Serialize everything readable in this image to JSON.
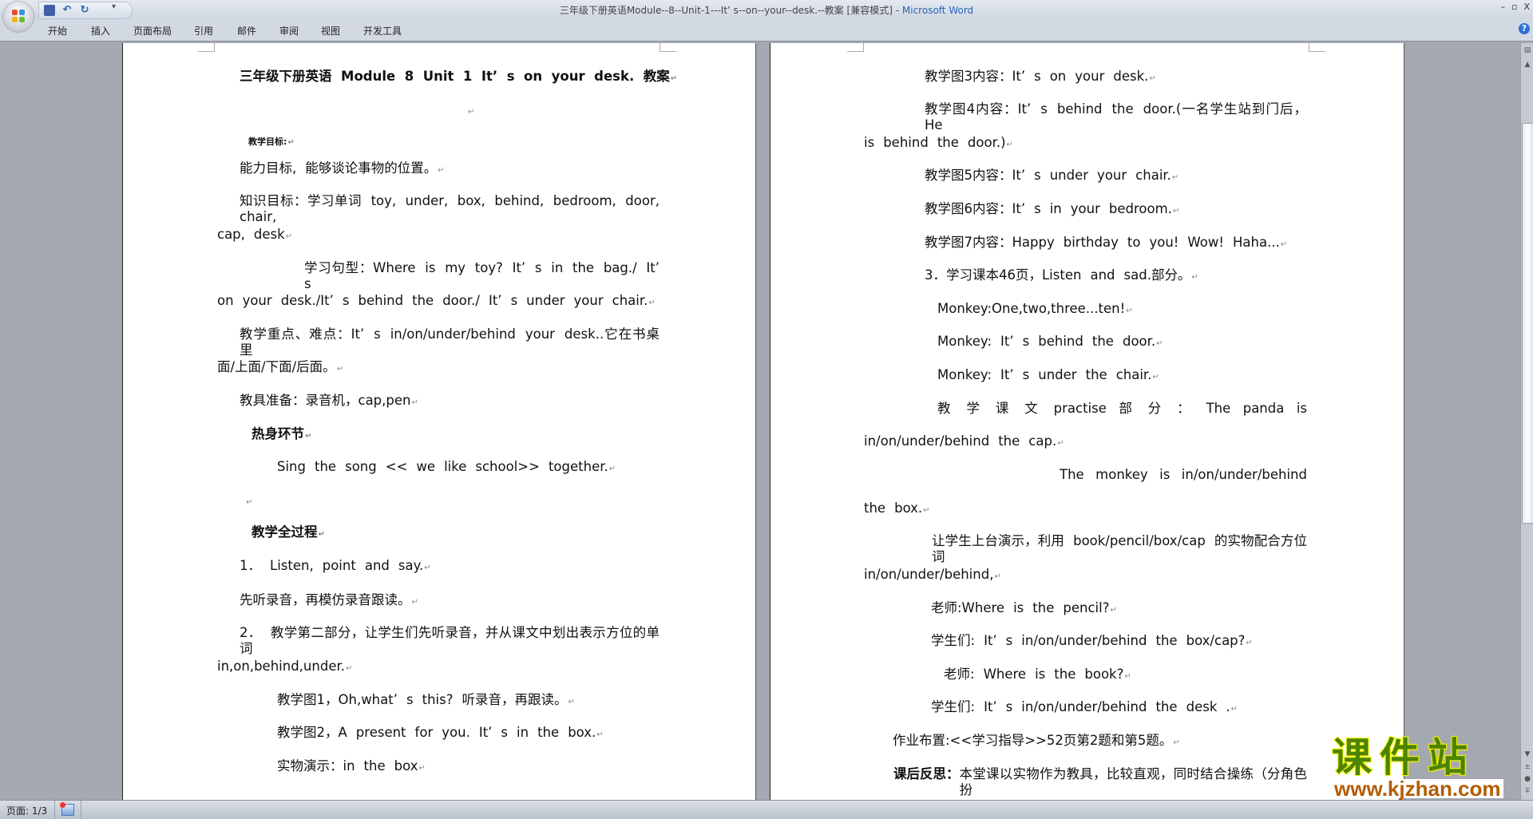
{
  "window": {
    "title": "三年级下册英语Module--8--Unit-1---It’ s--on--your--desk.--教案 [兼容模式]",
    "title_sep": " - ",
    "app_name": "Microsoft Word",
    "controls": [
      "–",
      "▫",
      "X"
    ]
  },
  "quick_access": {
    "icons": [
      "save-icon",
      "undo-icon",
      "redo-icon"
    ],
    "more": "▾"
  },
  "ribbon": {
    "tabs": [
      "开始",
      "插入",
      "页面布局",
      "引用",
      "邮件",
      "审阅",
      "视图",
      "开发工具"
    ],
    "help": "?"
  },
  "doc": {
    "left": [
      "三年级下册英语 Module  8  Unit 1   It’ s  on  your  desk.  教案",
      "",
      "教学目标:",
      "能力目标, 能够谈论事物的位置。",
      "知识目标：学习单词 toy,  under, box, behind, bedroom, door, chair,",
      "cap, desk",
      "学习句型：Where is  my  toy? It’ s  in  the  bag./ It’ s",
      "on  your desk./It’ s  behind  the  door./ It’ s  under  your chair.",
      "教学重点、难点：It’ s  in/on/under/behind  your  desk..它在书桌里",
      "面/上面/下面/后面。",
      "教具准备：录音机，cap,pen",
      "热身环节",
      "Sing  the  song  << we  like  school>>  together.",
      "",
      "教学全过程",
      "1． Listen, point  and  say.",
      "先听录音，再模仿录音跟读。",
      "2． 教学第二部分，让学生们先听录音，并从课文中划出表示方位的单词",
      "in,on,behind,under.",
      "教学图1，Oh,what’ s  this? 听录音，再跟读。",
      "教学图2，A present  for  you. It’ s  in  the  box.",
      "实物演示：in  the  box"
    ],
    "right": [
      "教学图3内容：It’ s  on  your  desk.",
      "教学图4内容：It’ s  behind  the  door.(一名学生站到门后，He",
      "is  behind  the  door.)",
      "教学图5内容：It’ s  under  your  chair.",
      "教学图6内容：It’ s  in  your  bedroom.",
      "教学图7内容：Happy  birthday  to  you!  Wow! Haha...",
      "3．学习课本46页，Listen  and  sad.部分。",
      "Monkey:One,two,three...ten!",
      "Monkey: It’ s  behind  the  door.",
      "Monkey: It’ s  under  the  chair.",
      "教 学 课 文  practise  部 分 ： The  panda  is",
      "in/on/under/behind  the  cap.",
      "The  monkey  is  in/on/under/behind",
      "the  box.",
      "让学生上台演示，利用 book/pencil/box/cap 的实物配合方位词",
      "in/on/under/behind,",
      "老师:Where  is  the  pencil?",
      "学生们: It’ s  in/on/under/behind  the  box/cap?",
      "老师: Where  is  the  book?",
      "学生们: It’ s  in/on/under/behind  the  desk .",
      "作业布置:<<学习指导>>52页第2题和第5题。",
      "本堂课以实物作为教具，比较直观，同时结合操练（分角色扮"
    ],
    "reflection_label": "课后反思：",
    "paragraph_mark": "↵"
  },
  "status_bar": {
    "page": "页面: 1/3"
  },
  "watermark": {
    "logo_text": "课件站",
    "url": "www.kjzhan.com"
  },
  "colors": {
    "app_name": "#2a64b8",
    "watermark_green": "#4d8400",
    "watermark_orange": "#b35c00"
  }
}
